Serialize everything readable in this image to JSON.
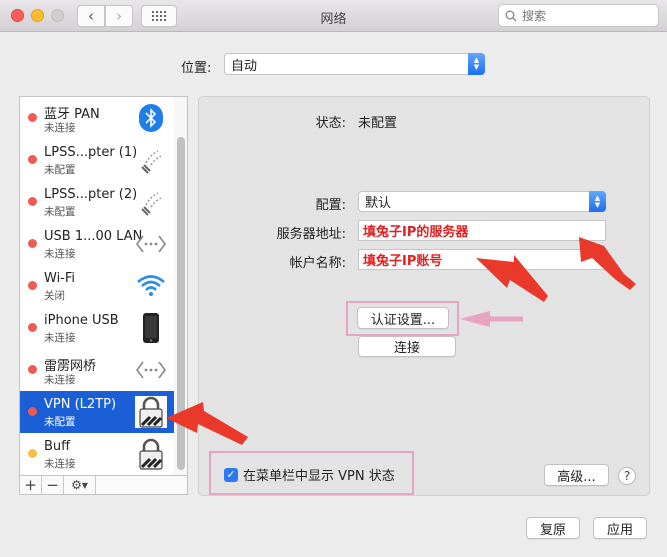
{
  "window": {
    "title": "网络"
  },
  "search": {
    "placeholder": "搜索"
  },
  "location": {
    "label": "位置:",
    "value": "自动"
  },
  "services": [
    {
      "name": "蓝牙 PAN",
      "status": "未连接",
      "dot": "#f05a54",
      "icon": "bluetooth-icon"
    },
    {
      "name": "LPSS...pter (1)",
      "status": "未配置",
      "dot": "#f05a54",
      "icon": "phone-icon"
    },
    {
      "name": "LPSS...pter (2)",
      "status": "未配置",
      "dot": "#f05a54",
      "icon": "phone-icon"
    },
    {
      "name": "USB 1...00 LAN",
      "status": "未连接",
      "dot": "#f05a54",
      "icon": "ethernet-icon"
    },
    {
      "name": "Wi-Fi",
      "status": "关闭",
      "dot": "#f05a54",
      "icon": "wifi-icon"
    },
    {
      "name": "iPhone USB",
      "status": "未连接",
      "dot": "#f05a54",
      "icon": "iphone-icon"
    },
    {
      "name": "雷雳网桥",
      "status": "未连接",
      "dot": "#f05a54",
      "icon": "bridge-icon"
    },
    {
      "name": "VPN (L2TP)",
      "status": "未配置",
      "dot": "#f05a54",
      "icon": "vpn-lock-icon",
      "selected": true
    },
    {
      "name": "Buff",
      "status": "未连接",
      "dot": "#f6c142",
      "icon": "vpn-lock-icon"
    }
  ],
  "sidebar_buttons": {
    "add": "+",
    "remove": "−",
    "gear": "⚙▾"
  },
  "detail": {
    "status_label": "状态:",
    "status_value": "未配置",
    "config_label": "配置:",
    "config_value": "默认",
    "server_label": "服务器地址:",
    "server_value": "填兔子IP的服务器",
    "account_label": "帐户名称:",
    "account_value": "填兔子IP账号",
    "auth_button": "认证设置...",
    "connect_button": "连接",
    "show_vpn_label": "在菜单栏中显示 VPN 状态",
    "show_vpn_checked": true,
    "advanced_button": "高级...",
    "help": "?"
  },
  "footer": {
    "revert": "复原",
    "apply": "应用"
  },
  "colors": {
    "accent": "#1a5fd6",
    "annotation_red": "#e8392a",
    "annotation_pink": "#e6a3c2"
  }
}
